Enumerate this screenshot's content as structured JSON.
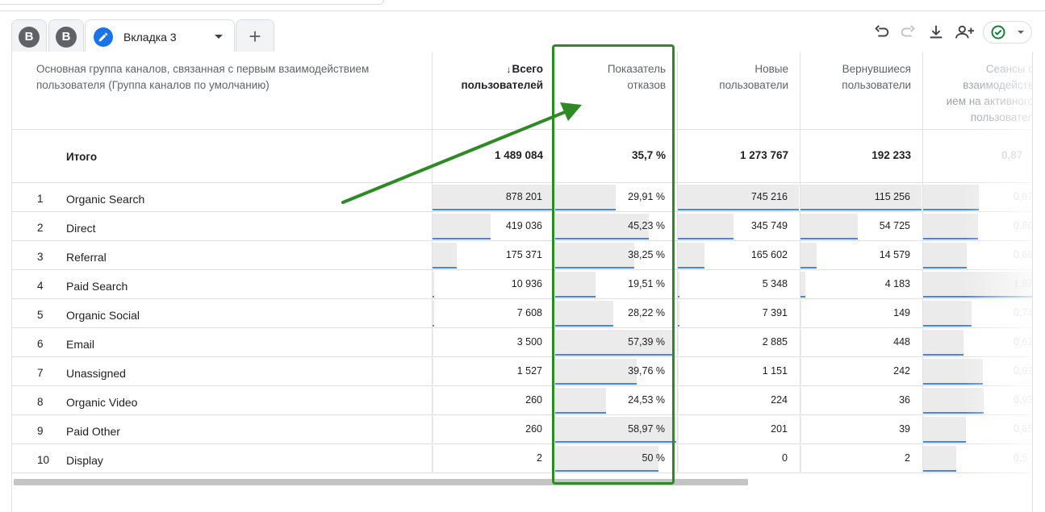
{
  "tabs": {
    "items": [
      {
        "letter": "B"
      },
      {
        "letter": "B"
      },
      {
        "label": "Вкладка 3",
        "icon": "pencil-icon"
      }
    ],
    "add_label": "+"
  },
  "toolbar": {
    "icons": [
      "undo-icon",
      "redo-icon",
      "download-icon",
      "share-user-icon",
      "check-circle-icon"
    ],
    "status_color": "#188038"
  },
  "table": {
    "dimension_header": "Основная группа каналов, связанная с первым взаимодействием пользователя (Группа каналов по умолчанию)",
    "columns": [
      {
        "line1": "Всего",
        "line2": "пользователей",
        "sort_arrow": "↓"
      },
      {
        "line1": "Показатель",
        "line2": "отказов"
      },
      {
        "line1": "Новые",
        "line2": "пользователи"
      },
      {
        "line1": "Вернувшиеся",
        "line2": "пользователи"
      },
      {
        "line1": "Сеансы с",
        "line2": "взаимодейств",
        "line3": "ием на активного",
        "line4": "пользовател"
      }
    ],
    "totals": {
      "label": "Итого",
      "values": [
        "1 489 084",
        "35,7 %",
        "1 273 767",
        "192 233",
        "0,87"
      ]
    },
    "rows": [
      {
        "num": "1",
        "name": "Organic Search",
        "values": [
          "878 201",
          "29,91 %",
          "745 216",
          "115 256",
          "0,87"
        ],
        "fill": [
          1.0,
          0.5,
          1.0,
          1.0,
          0.46
        ]
      },
      {
        "num": "2",
        "name": "Direct",
        "values": [
          "419 036",
          "45,23 %",
          "345 749",
          "54 725",
          "0,86"
        ],
        "fill": [
          0.48,
          0.77,
          0.46,
          0.47,
          0.45
        ]
      },
      {
        "num": "3",
        "name": "Referral",
        "values": [
          "175 371",
          "38,25 %",
          "165 602",
          "14 579",
          "0,68"
        ],
        "fill": [
          0.2,
          0.65,
          0.22,
          0.13,
          0.36
        ]
      },
      {
        "num": "4",
        "name": "Paid Search",
        "values": [
          "10 936",
          "19,51 %",
          "5 348",
          "4 183",
          "1,87"
        ],
        "fill": [
          0.01,
          0.33,
          0.01,
          0.04,
          1.0
        ]
      },
      {
        "num": "5",
        "name": "Organic Social",
        "values": [
          "7 608",
          "28,22 %",
          "7 391",
          "149",
          "0,74"
        ],
        "fill": [
          0.01,
          0.48,
          0.01,
          0.0,
          0.4
        ]
      },
      {
        "num": "6",
        "name": "Email",
        "values": [
          "3 500",
          "57,39 %",
          "2 885",
          "448",
          "0,61"
        ],
        "fill": [
          0.0,
          0.97,
          0.0,
          0.0,
          0.33
        ]
      },
      {
        "num": "7",
        "name": "Unassigned",
        "values": [
          "1 527",
          "39,76 %",
          "1 151",
          "242",
          "0,92"
        ],
        "fill": [
          0.0,
          0.67,
          0.0,
          0.0,
          0.49
        ]
      },
      {
        "num": "8",
        "name": "Organic Video",
        "values": [
          "260",
          "24,53 %",
          "224",
          "36",
          "0,93"
        ],
        "fill": [
          0.0,
          0.42,
          0.0,
          0.0,
          0.5
        ]
      },
      {
        "num": "9",
        "name": "Paid Other",
        "values": [
          "260",
          "58,97 %",
          "201",
          "39",
          "0,65"
        ],
        "fill": [
          0.0,
          1.0,
          0.0,
          0.0,
          0.35
        ]
      },
      {
        "num": "10",
        "name": "Display",
        "values": [
          "2",
          "50 %",
          "0",
          "2",
          "0,5"
        ],
        "fill": [
          0.0,
          0.85,
          0.0,
          0.0,
          0.27
        ]
      }
    ]
  },
  "annotation": {
    "color": "#2e8a24",
    "target_column": "Показатель отказов"
  }
}
